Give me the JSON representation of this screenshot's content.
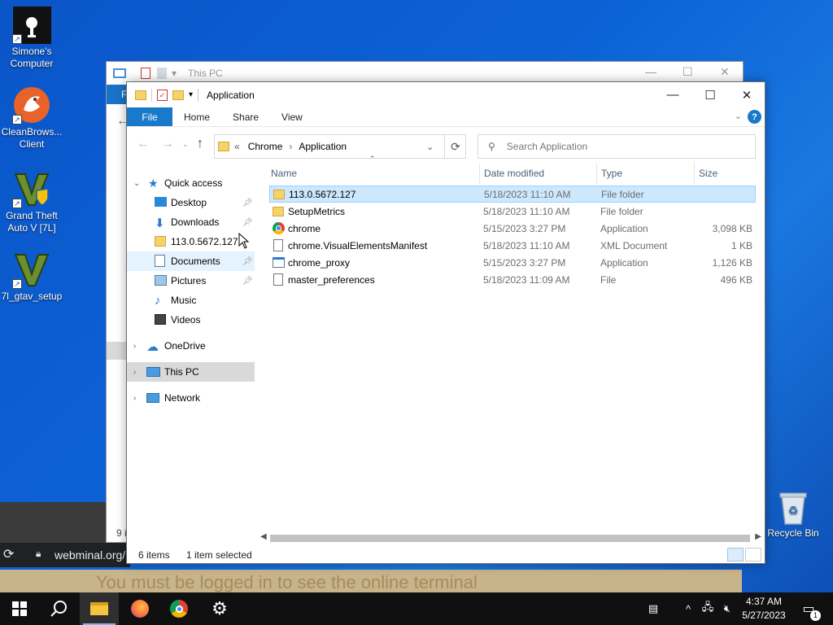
{
  "desktop": {
    "icons": [
      {
        "label": "Simone's Computer",
        "icon": "computer-icon"
      },
      {
        "label": "CleanBrows... Client",
        "icon": "cleanbrowsing-icon"
      },
      {
        "label": "Grand Theft Auto V [7L]",
        "icon": "gtav-icon"
      },
      {
        "label": "7l_gtav_setup",
        "icon": "gtav-setup-icon"
      }
    ],
    "recycle_bin": "Recycle Bin"
  },
  "browser": {
    "url": "webminal.org/",
    "bottom_text": "You must be logged in to see the online terminal"
  },
  "back_window": {
    "title": "This PC",
    "ribbon_file": "F",
    "items_count": "9 i"
  },
  "window": {
    "title": "Application",
    "menu": {
      "file": "File",
      "tabs": [
        "Home",
        "Share",
        "View"
      ],
      "help": "?"
    },
    "address": {
      "overflow": "«",
      "crumbs": [
        "Chrome",
        "Application"
      ]
    },
    "search_placeholder": "Search Application",
    "nav": {
      "quick_access": "Quick access",
      "items": [
        {
          "label": "Desktop",
          "icon": "desktop-icon",
          "pinned": true
        },
        {
          "label": "Downloads",
          "icon": "downloads-icon",
          "pinned": true
        },
        {
          "label": "113.0.5672.127",
          "icon": "folder-icon",
          "pinned": false
        },
        {
          "label": "Documents",
          "icon": "documents-icon",
          "pinned": true
        },
        {
          "label": "Pictures",
          "icon": "pictures-icon",
          "pinned": true
        },
        {
          "label": "Music",
          "icon": "music-icon",
          "pinned": false
        },
        {
          "label": "Videos",
          "icon": "videos-icon",
          "pinned": false
        }
      ],
      "onedrive": "OneDrive",
      "this_pc": "This PC",
      "network": "Network"
    },
    "columns": [
      "Name",
      "Date modified",
      "Type",
      "Size"
    ],
    "files": [
      {
        "name": "113.0.5672.127",
        "date": "5/18/2023 11:10 AM",
        "type": "File folder",
        "size": "",
        "icon": "folder-icon"
      },
      {
        "name": "SetupMetrics",
        "date": "5/18/2023 11:10 AM",
        "type": "File folder",
        "size": "",
        "icon": "folder-icon"
      },
      {
        "name": "chrome",
        "date": "5/15/2023 3:27 PM",
        "type": "Application",
        "size": "3,098 KB",
        "icon": "chrome-icon"
      },
      {
        "name": "chrome.VisualElementsManifest",
        "date": "5/18/2023 11:10 AM",
        "type": "XML Document",
        "size": "1 KB",
        "icon": "xml-file-icon"
      },
      {
        "name": "chrome_proxy",
        "date": "5/15/2023 3:27 PM",
        "type": "Application",
        "size": "1,126 KB",
        "icon": "app-icon"
      },
      {
        "name": "master_preferences",
        "date": "5/18/2023 11:09 AM",
        "type": "File",
        "size": "496 KB",
        "icon": "file-icon"
      }
    ],
    "status": {
      "count": "6 items",
      "selected": "1 item selected"
    }
  },
  "taskbar": {
    "time": "4:37 AM",
    "date": "5/27/2023",
    "notifications": "1"
  }
}
